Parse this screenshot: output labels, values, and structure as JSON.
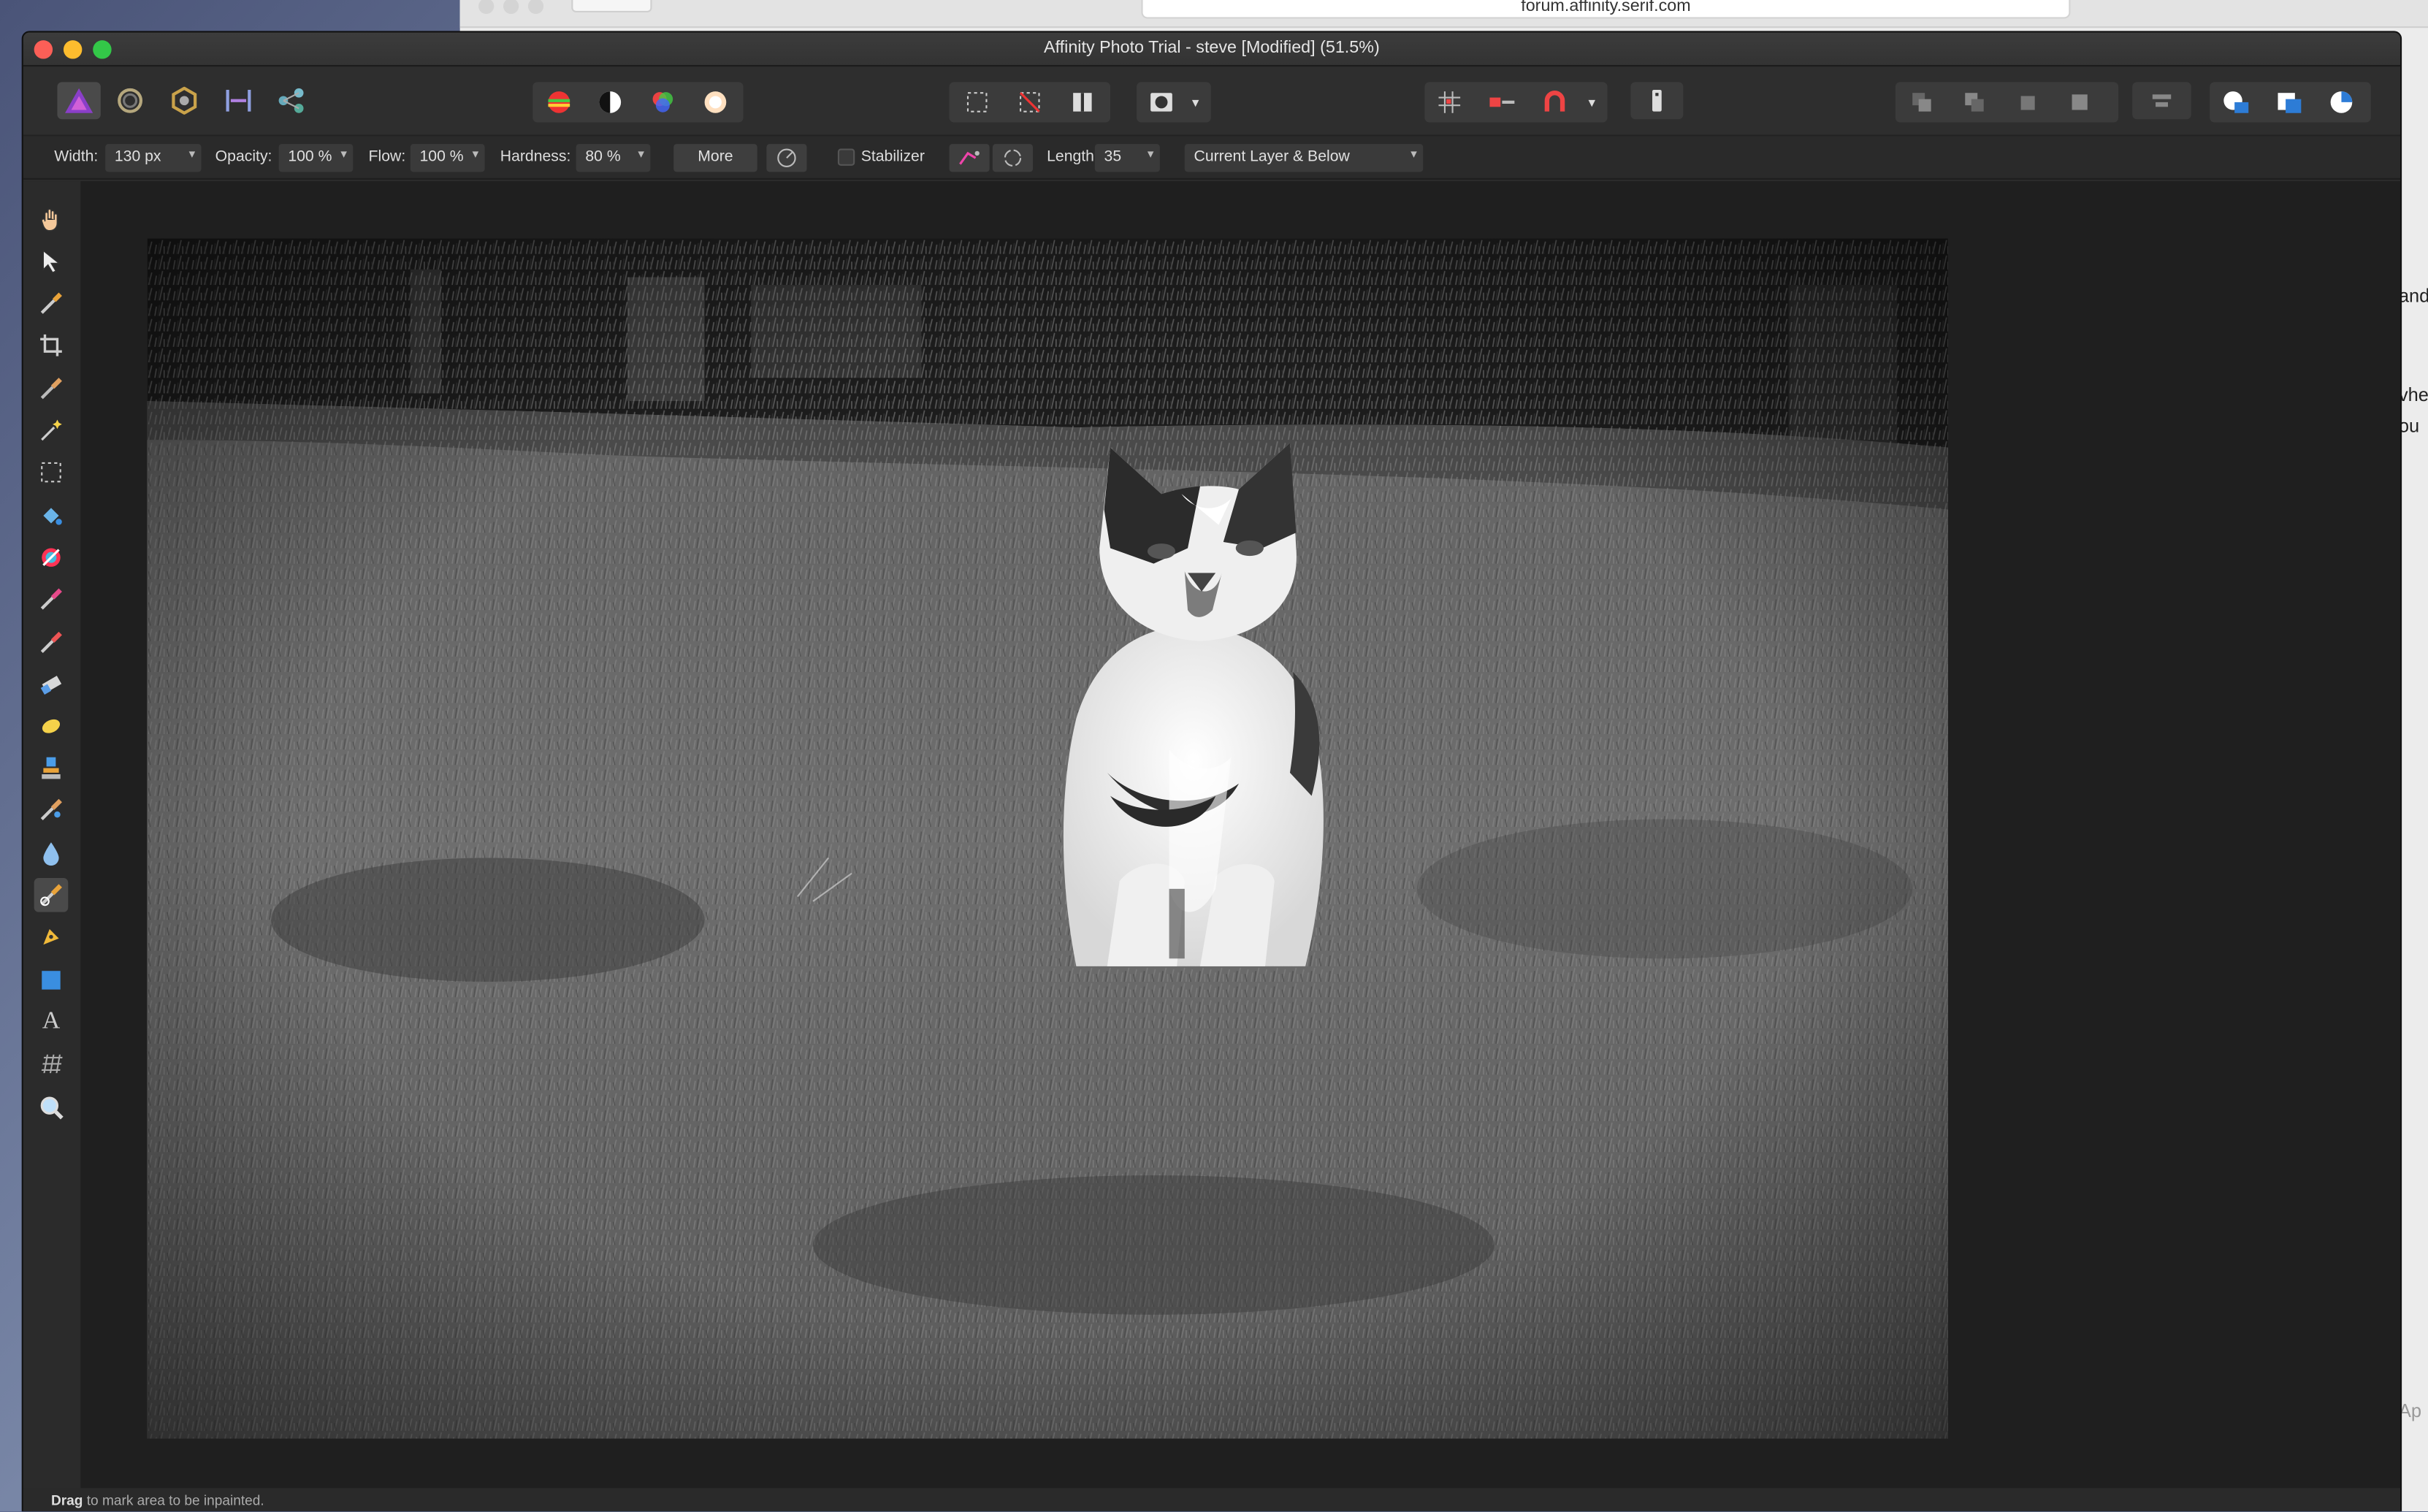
{
  "browser": {
    "url": "forum.affinity.serif.com",
    "side_fragments": [
      "and",
      "vhe",
      "ou",
      "Ap"
    ]
  },
  "window": {
    "title": "Affinity Photo Trial - steve [Modified] (51.5%)"
  },
  "personas": [
    "photo-persona-icon",
    "liquify-persona-icon",
    "develop-persona-icon",
    "tone-mapping-persona-icon",
    "export-persona-icon"
  ],
  "context_toolbar": {
    "width_label": "Width:",
    "width_value": "130 px",
    "opacity_label": "Opacity:",
    "opacity_value": "100 %",
    "flow_label": "Flow:",
    "flow_value": "100 %",
    "hardness_label": "Hardness:",
    "hardness_value": "80 %",
    "more_label": "More",
    "stabilizer_label": "Stabilizer",
    "length_label": "Length:",
    "length_value": "35",
    "sample_value": "Current Layer & Below"
  },
  "tools": [
    "hand-tool-icon",
    "move-tool-icon",
    "color-picker-icon",
    "crop-tool-icon",
    "selection-brush-icon",
    "flood-select-icon",
    "marquee-tool-icon",
    "flood-fill-icon",
    "gradient-tool-icon",
    "paint-brush-icon",
    "color-replacement-icon",
    "erase-brush-icon",
    "dodge-brush-icon",
    "clone-brush-icon",
    "healing-brush-icon",
    "blur-brush-icon",
    "inpainting-brush-icon",
    "pen-tool-icon",
    "rectangle-tool-icon",
    "text-tool-icon",
    "mesh-warp-icon",
    "zoom-tool-icon"
  ],
  "status": {
    "bold": "Drag",
    "text": " to mark area to be inpainted."
  },
  "colors": {
    "accent_red": "#fc5f57",
    "accent_yellow": "#fdbc2e",
    "accent_green": "#33c748"
  }
}
